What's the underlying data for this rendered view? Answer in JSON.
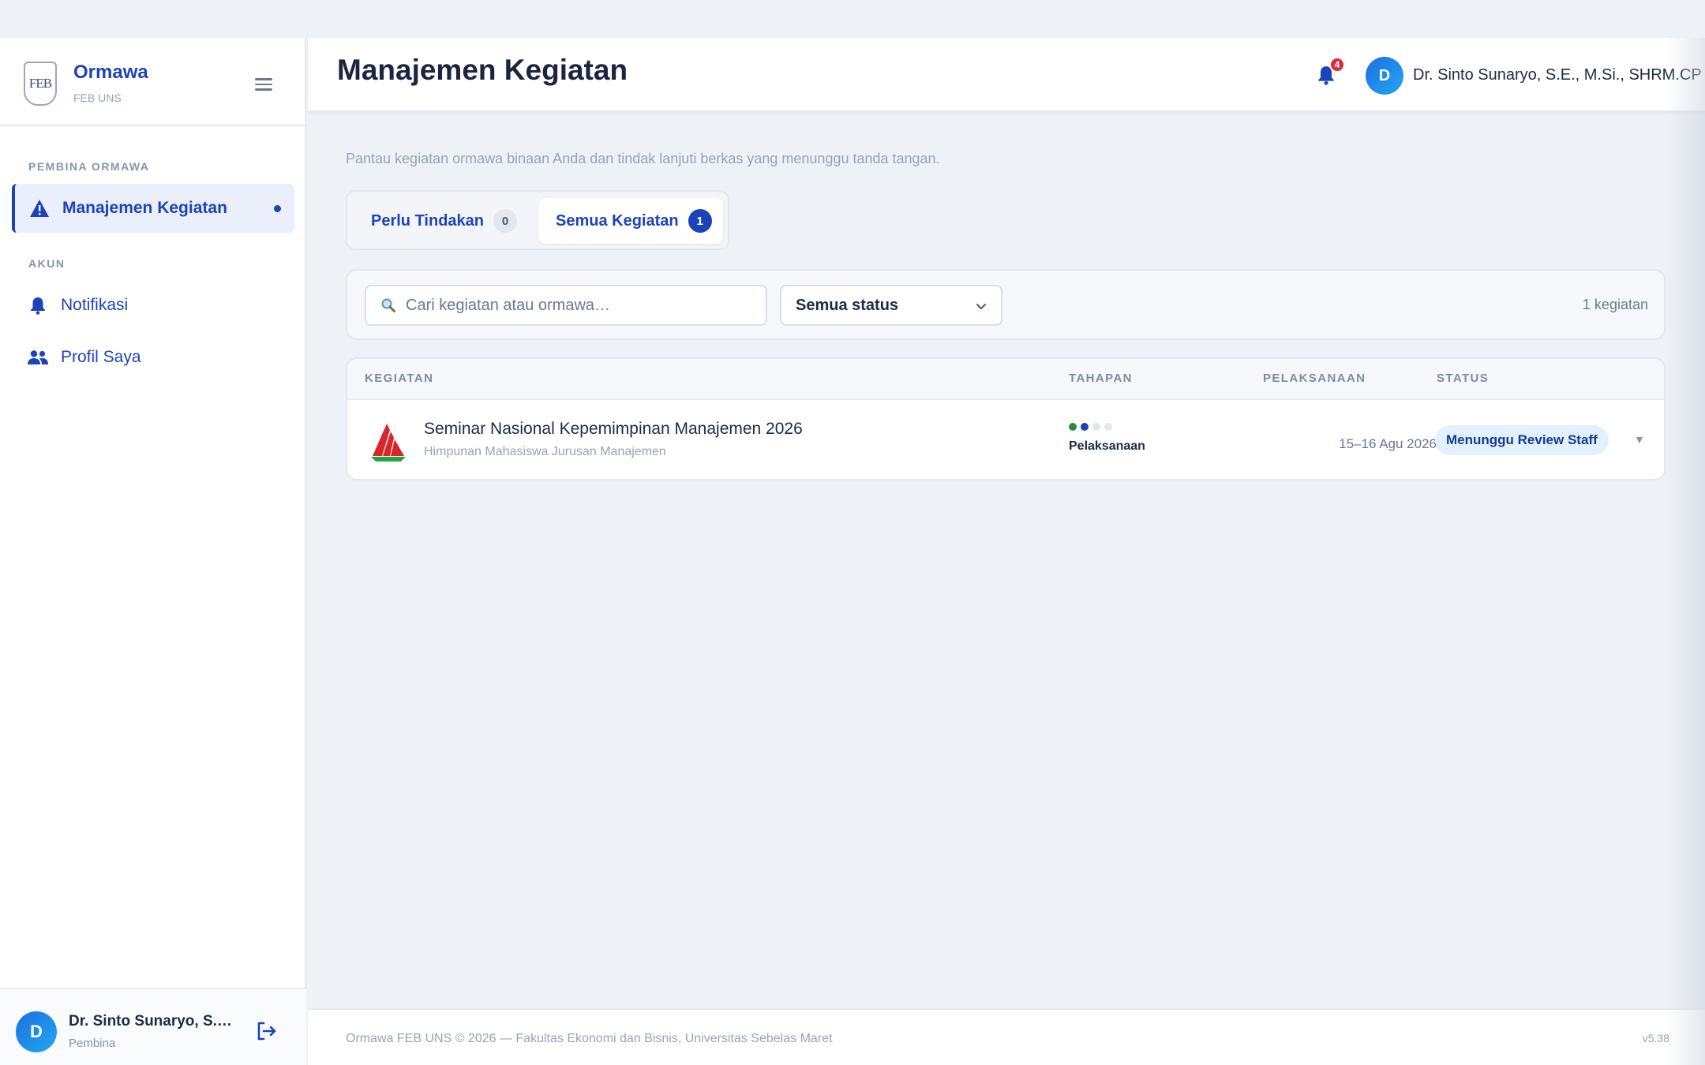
{
  "brand": {
    "name": "Ormawa",
    "sub": "FEB UNS",
    "logo_text": "FEB"
  },
  "sidebar": {
    "sections": [
      {
        "label": "PEMBINA ORMAWA"
      },
      {
        "label": "AKUN"
      }
    ],
    "items": [
      {
        "label": "Manajemen Kegiatan",
        "icon": "warning-triangle-icon",
        "active": true
      },
      {
        "label": "Notifikasi",
        "icon": "bell-icon"
      },
      {
        "label": "Profil Saya",
        "icon": "people-icon"
      }
    ],
    "user": {
      "initial": "D",
      "name": "Dr. Sinto Sunaryo, S.E.,...",
      "role": "Pembina"
    }
  },
  "header": {
    "title": "Manajemen Kegiatan",
    "notification_count": "4",
    "user_initial": "D",
    "user_name": "Dr. Sinto Sunaryo, S.E., M.Si., SHRM.CP"
  },
  "main": {
    "subtitle": "Pantau kegiatan ormawa binaan Anda dan tindak lanjuti berkas yang menunggu tanda tangan.",
    "tabs": [
      {
        "label": "Perlu Tindakan",
        "count": "0"
      },
      {
        "label": "Semua Kegiatan",
        "count": "1",
        "active": true
      }
    ],
    "search": {
      "placeholder": "Cari kegiatan atau ormawa…",
      "value": ""
    },
    "status_filter": {
      "selected": "Semua status"
    },
    "result_count": "1 kegiatan",
    "table": {
      "columns": [
        "KEGIATAN",
        "TAHAPAN",
        "PELAKSANAAN",
        "STATUS"
      ],
      "rows": [
        {
          "title": "Seminar Nasional Kepemimpinan Manajemen 2026",
          "org": "Himpunan Mahasiswa Jurusan Manajemen",
          "stage_name": "Pelaksanaan",
          "stage_progress": {
            "done": 1,
            "current": 2,
            "total": 4
          },
          "date": "15–16 Agu 2026",
          "status": "Menunggu Review Staff"
        }
      ]
    }
  },
  "footer": {
    "text": "Ormawa FEB UNS © 2026 — Fakultas Ekonomi dan Bisnis, Universitas Sebelas Maret",
    "version": "v5.38"
  },
  "colors": {
    "accent": "#1d43b8",
    "badge_red": "#d92d3a",
    "stage_done": "#2e8b3e",
    "status_bg": "#e3f1fd"
  }
}
